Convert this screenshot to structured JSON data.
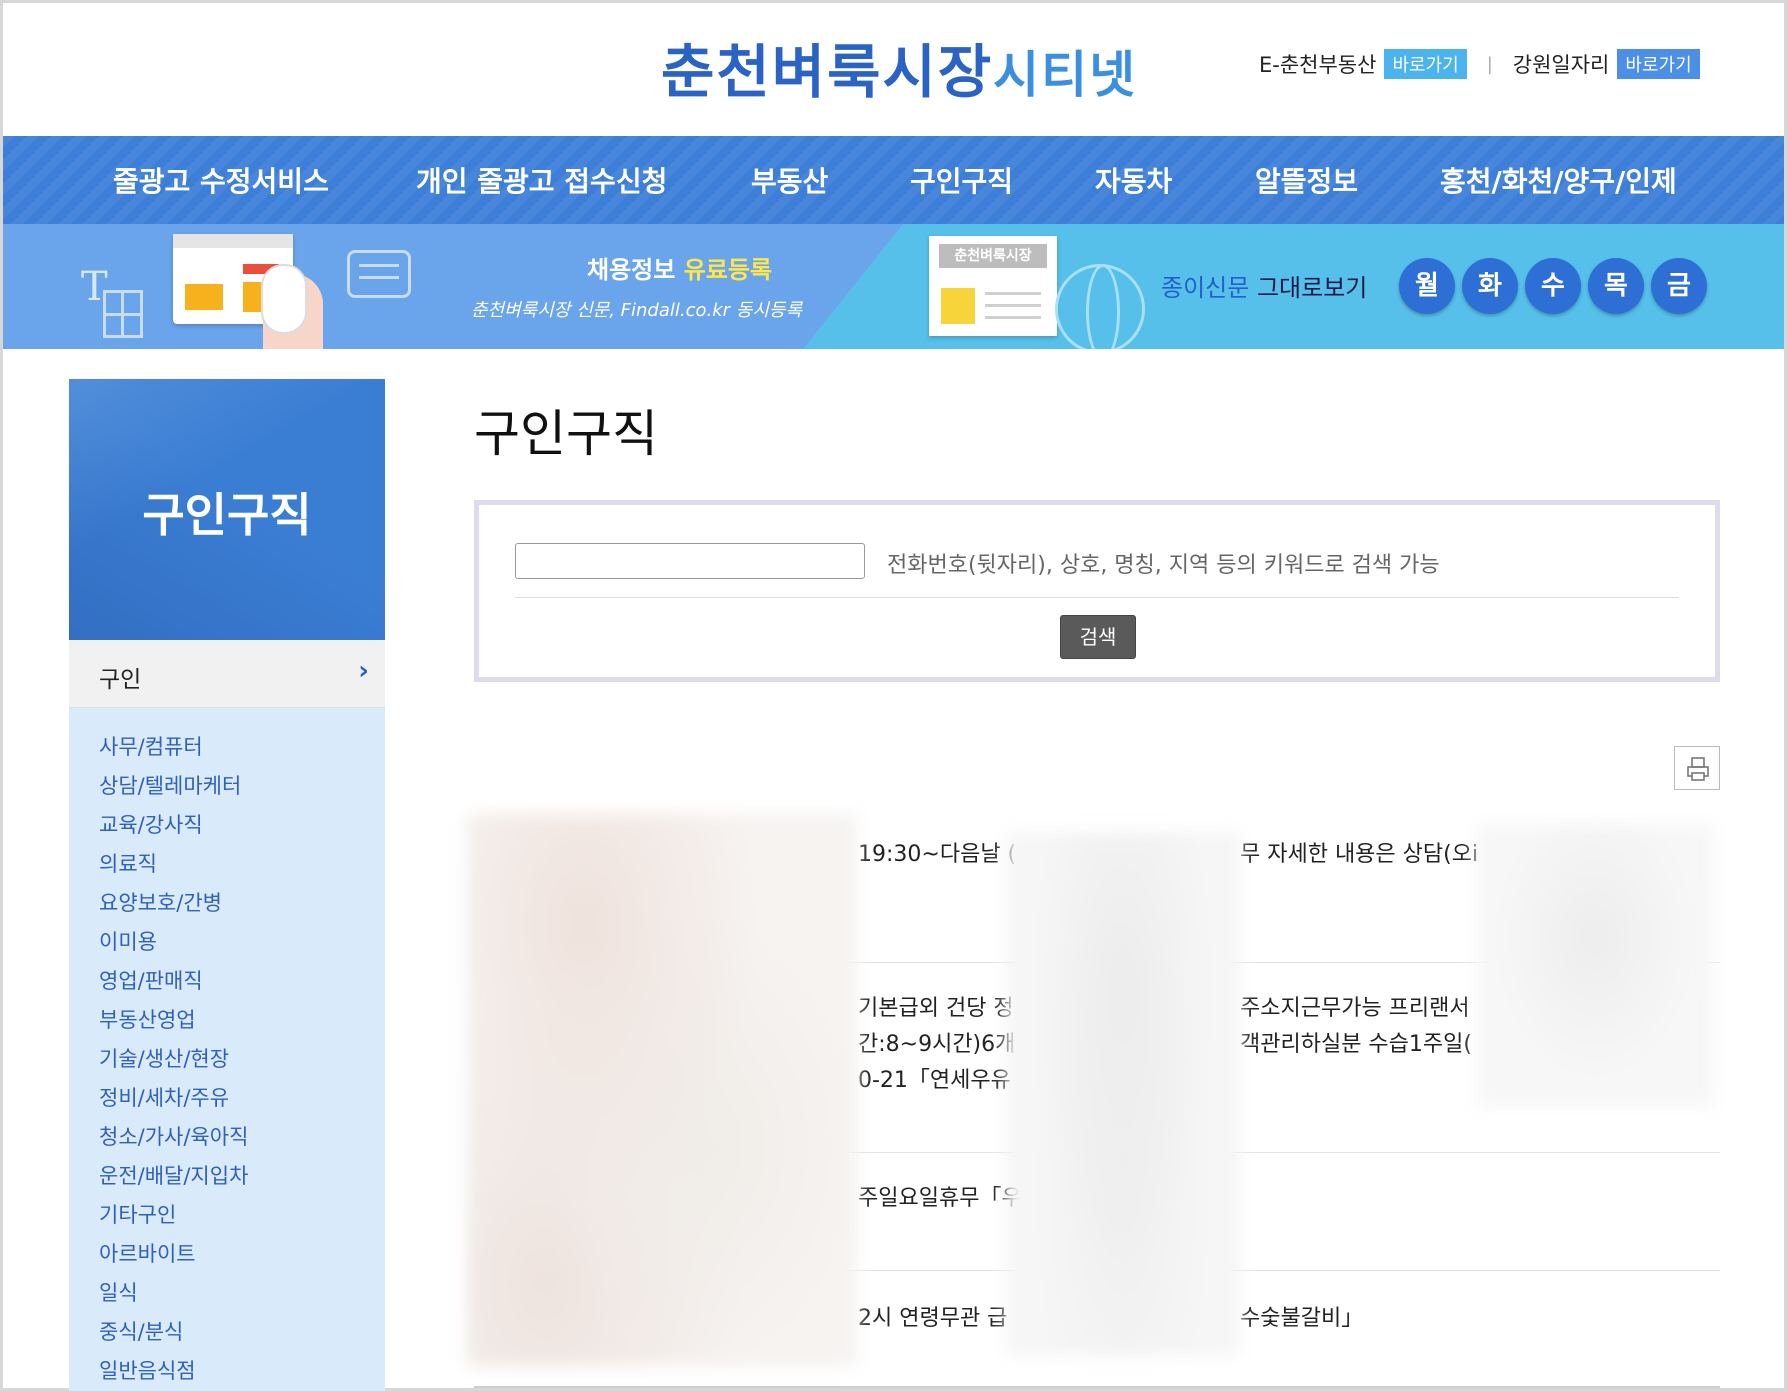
{
  "header": {
    "logo_main": "춘천벼룩시장",
    "logo_sub": "시티넷",
    "links": [
      {
        "label": "E-춘천부동산",
        "badge": "바로가기"
      },
      {
        "label": "강원일자리",
        "badge": "바로가기"
      }
    ],
    "separator": "|"
  },
  "nav": {
    "items": [
      "줄광고 수정서비스",
      "개인 줄광고 접수신청",
      "부동산",
      "구인구직",
      "자동차",
      "알뜰정보",
      "홍천/화천/양구/인제"
    ]
  },
  "banner": {
    "title_pre": "채용정보 ",
    "title_highlight": "유료등록",
    "subtitle": "춘천벼룩시장 신문, Findall.co.kr 동시등록",
    "paper_header": "춘천벼룩시장",
    "paper_link_accent": "종이신문",
    "paper_link_rest": " 그대로보기",
    "days": [
      "월",
      "화",
      "수",
      "목",
      "금"
    ]
  },
  "sidebar": {
    "title": "구인구직",
    "current": "구인",
    "items": [
      "사무/컴퓨터",
      "상담/텔레마케터",
      "교육/강사직",
      "의료직",
      "요양보호/간병",
      "이미용",
      "영업/판매직",
      "부동산영업",
      "기술/생산/현장",
      "정비/세차/주유",
      "청소/가사/육아직",
      "운전/배달/지입차",
      "기타구인",
      "아르바이트",
      "일식",
      "중식/분식",
      "일반음식점"
    ]
  },
  "main": {
    "title": "구인구직",
    "search": {
      "value": "",
      "hint": "전화번호(뒷자리), 상호, 명칭, 지역 등의 키워드로 검색 가능",
      "button": "검색"
    },
    "listing_fragments": [
      [
        "19:30~다음날 (",
        "무 자세한 내용은 상담(오i"
      ],
      [
        "기본급외 건당 정",
        "주소지근무가능 프리랜서"
      ],
      [
        "간:8~9시간)6개",
        "객관리하실분 수습1주일("
      ],
      [
        "0-21「연세우유",
        ""
      ],
      [
        "주일요일휴무「우",
        ""
      ],
      [
        "2시 연령무관 급",
        "수숯불갈비」"
      ]
    ]
  }
}
